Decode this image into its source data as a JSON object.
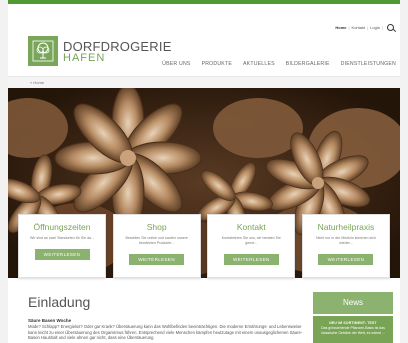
{
  "colors": {
    "accent": "#79a355",
    "button": "#8bb26e",
    "topbar": "#4f9a32"
  },
  "toplinks": {
    "home": "Home",
    "kontakt": "Kontakt",
    "login": "Login",
    "search_icon": "search-icon"
  },
  "brand": {
    "line1": "DORFDROGERIE",
    "line2": "HAFEN",
    "logo_icon": "tree-icon"
  },
  "nav": {
    "items": [
      "ÜBER UNS",
      "PRODUKTE",
      "AKTUELLES",
      "BILDERGALERIE",
      "DIENSTLEISTUNGEN"
    ]
  },
  "breadcrumb": "» Home",
  "cards": [
    {
      "title": "Öffnungszeiten",
      "text": "Wir sind an zwei Standorten für Sie da...",
      "button": "WEITERLESEN"
    },
    {
      "title": "Shop",
      "text": "Bestellen Sie online und kaufen unsere bewährten Produkte...",
      "button": "WEITERLESEN"
    },
    {
      "title": "Kontakt",
      "text": "Kontaktieren Sie uns, wir beraten Sie gerne...",
      "button": "WEITERLESEN"
    },
    {
      "title": "Naturheilpraxis",
      "text": "Nicht nur in der Medizin kommen sich wieder...",
      "button": "WEITERLESEN"
    }
  ],
  "main": {
    "heading": "Einladung",
    "subheading": "Säure Basen Woche",
    "body": "Müde? Schlapp? Energielos? Oder gar Krank? Übersäuerung kann das Wohlbefinden beeinträchtigen. Die moderne Ernährungs- und Lebensweise kann leicht zu einer Übersäuerung des Organismus führen. Entsprechend viele Menschen kämpfen heutzutage mit einem unausgeglichenen Säure-Basen Haushalt und viele ahnen gar nicht, dass eine Übersäuerung"
  },
  "news": {
    "title": "News",
    "headline": "NEU IM SORTIMENT: TEST",
    "text": "Das grösstehende Pflanzen-Basis ist das klassische Getränk der Welt, es wärmt ..."
  }
}
